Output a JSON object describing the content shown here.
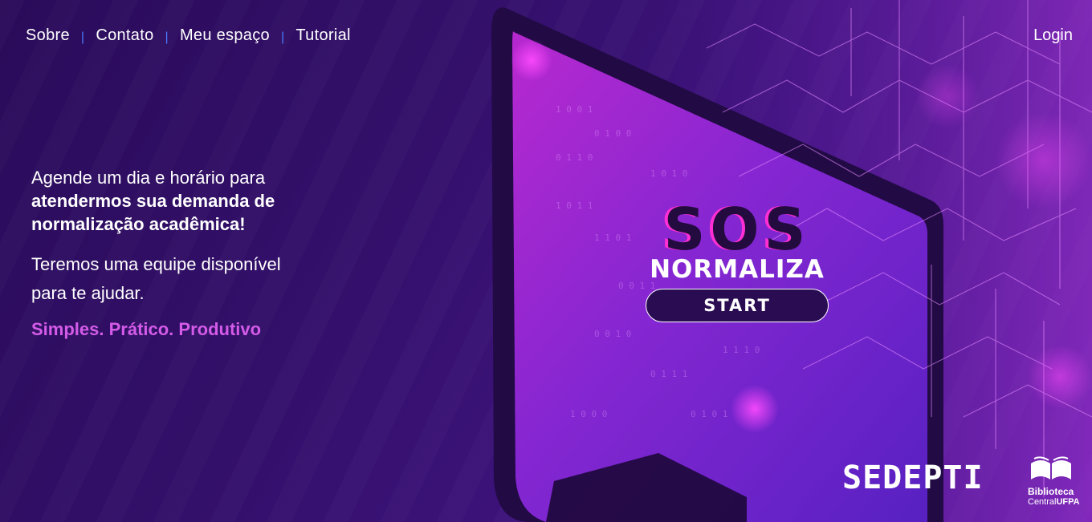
{
  "nav": {
    "items": [
      "Sobre",
      "Contato",
      "Meu espaço",
      "Tutorial"
    ],
    "separator": "|",
    "login": "Login"
  },
  "hero": {
    "line1": "Agende um dia e horário para",
    "line2": "atendermos sua demanda de",
    "line3": "normalização acadêmica!",
    "line4": "Teremos uma equipe disponível",
    "line5": "para te ajudar.",
    "tagline": "Simples. Prático. Produtivo"
  },
  "brand": {
    "sos": "SOS",
    "normaliza": "NORMALIZA",
    "start": "START"
  },
  "logos": {
    "sedepti": "SEDEPTI",
    "library_line1": "Biblioteca",
    "library_central": "Central",
    "library_ufpa": "UFPA"
  },
  "colors": {
    "accent_pink": "#d35be8",
    "nav_separator": "#4b7bff",
    "background": "#33106a"
  }
}
